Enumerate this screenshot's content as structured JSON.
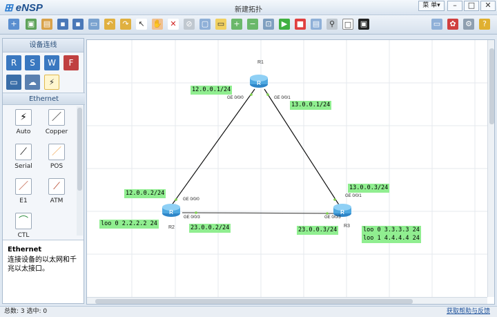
{
  "app": {
    "logo": "eNSP",
    "window_title": "新建拓扑",
    "menu_label": "菜 单▾"
  },
  "window_controls": [
    {
      "name": "minimize",
      "glyph": "–"
    },
    {
      "name": "maximize",
      "glyph": "□"
    },
    {
      "name": "close",
      "glyph": "✕"
    }
  ],
  "left_panel": {
    "header": "设备连线",
    "category": "Ethernet",
    "cables": [
      {
        "label": "Auto",
        "glyph": "⚡",
        "color": "#222222"
      },
      {
        "label": "Copper",
        "glyph": "／",
        "color": "#222222"
      },
      {
        "label": "Serial",
        "glyph": "⟋",
        "color": "#222222"
      },
      {
        "label": "POS",
        "glyph": "／",
        "color": "#f0a040"
      },
      {
        "label": "E1",
        "glyph": "／",
        "color": "#b23a1c"
      },
      {
        "label": "ATM",
        "glyph": "⟋",
        "color": "#b23a1c"
      },
      {
        "label": "CTL",
        "glyph": "⌒",
        "color": "#2a8a3a"
      }
    ],
    "description_title": "Ethernet",
    "description_text": "连接设备的以太网和千兆以太接口。"
  },
  "canvas": {
    "nodes": [
      {
        "id": "R1",
        "label": "R1"
      },
      {
        "id": "R2",
        "label": "R2"
      },
      {
        "id": "R3",
        "label": "R3"
      }
    ],
    "ports": {
      "r1_g000": "GE 0/0/0",
      "r1_g001": "GE 0/0/1",
      "r2_g000": "GE 0/0/0",
      "r2_g003": "GE 0/0/3",
      "r3_g001": "GE 0/0/1",
      "r3_g003": "GE 0/0/3"
    },
    "ip_labels": {
      "r1_left": "12.0.0.1/24",
      "r1_right": "13.0.0.1/24",
      "r2_top": "12.0.0.2/24",
      "r2_loop": "loo 0 2.2.2.2 24",
      "r2_bottom": "23.0.0.2/24",
      "r3_top": "13.0.0.3/24",
      "r3_bottom": "23.0.0.3/24",
      "r3_loop0": "loo 0 3.3.3.3 24",
      "r3_loop1": "loo 1 4.4.4.4 24"
    }
  },
  "status": {
    "left": "总数: 3 选中: 0",
    "right": "获取帮助与反馈"
  },
  "colors": {
    "ip_label_bg": "#90ee90",
    "router_blue": "#4fa8e0",
    "link_green": "#7cd04a"
  }
}
